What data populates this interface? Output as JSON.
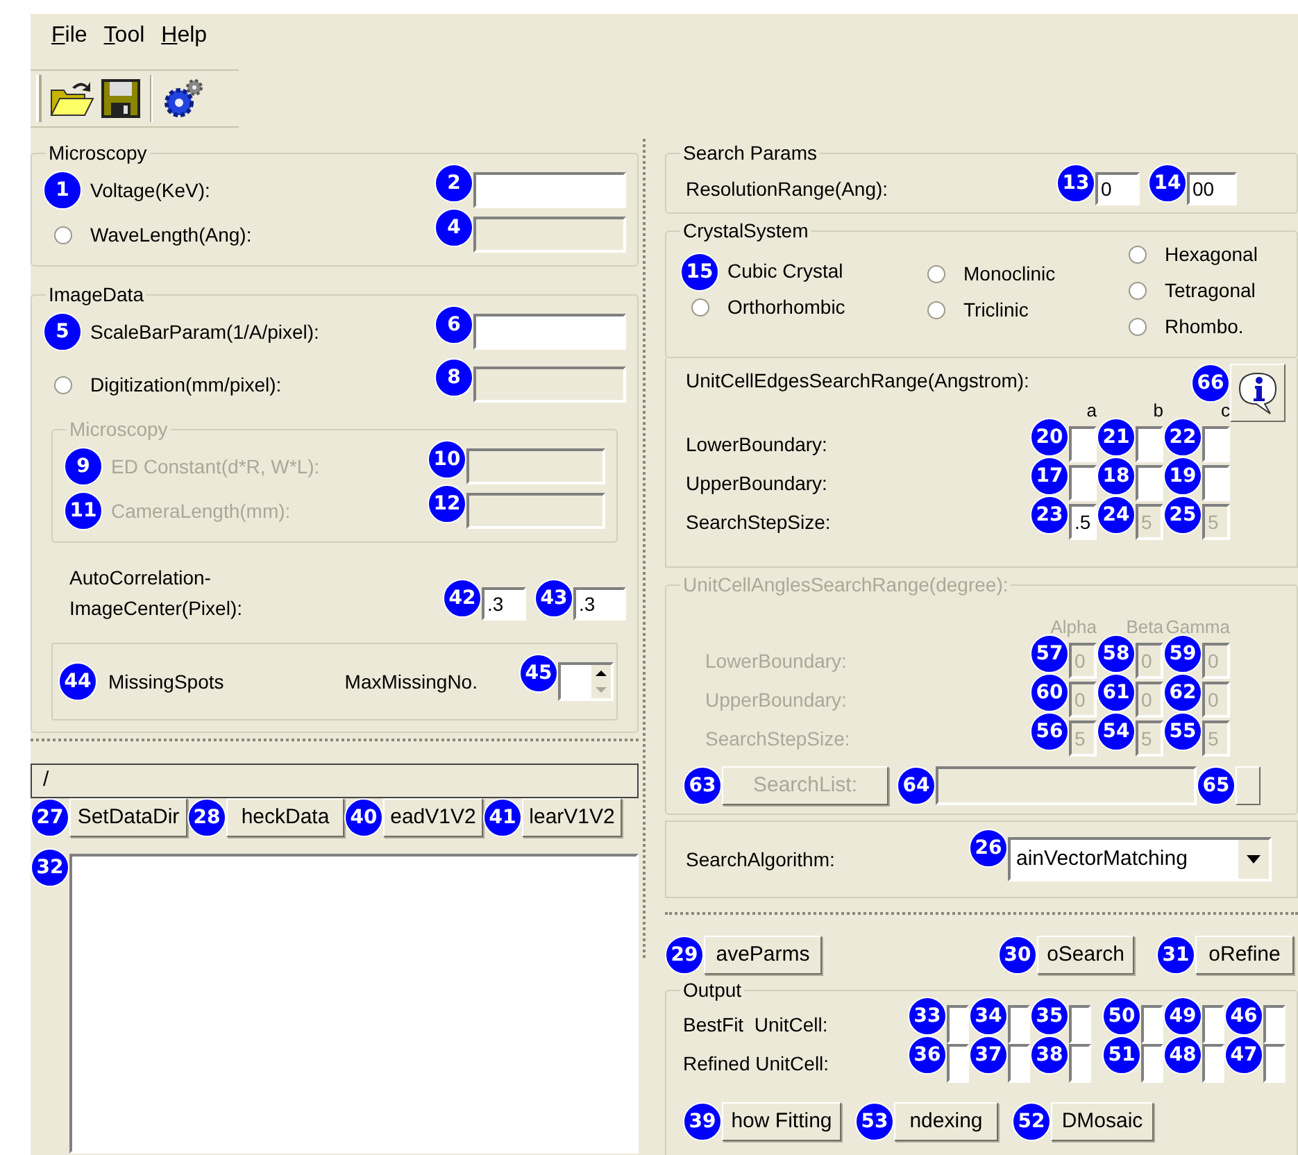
{
  "menu": [
    {
      "label": "File"
    },
    {
      "label": "Tool"
    },
    {
      "label": "Help"
    }
  ],
  "microscopy": {
    "title": "Microscopy",
    "rows": [
      {
        "label": "Voltage(KeV):",
        "badge": "1",
        "field": {
          "badge": "2",
          "disabled": false
        }
      },
      {
        "label": "WaveLength(Ang):",
        "selected": false,
        "field": {
          "badge": "4",
          "disabled": true
        }
      }
    ]
  },
  "image_data": {
    "title": "ImageData",
    "rows": [
      {
        "label": "ScaleBarParam(1/A/pixel):",
        "badge": "5",
        "field": {
          "badge": "6",
          "disabled": false
        }
      },
      {
        "label": "Digitization(mm/pixel):",
        "selected": false,
        "field": {
          "badge": "8",
          "disabled": true
        }
      }
    ],
    "microscopy": {
      "title": "Microscopy",
      "disabled": true,
      "rows": [
        {
          "label": "ED Constant(d*R, W*L):",
          "badge": "9",
          "field": {
            "badge": "10",
            "disabled": true
          }
        },
        {
          "label": "CameraLength(mm):",
          "badge": "11",
          "field": {
            "badge": "12",
            "disabled": true
          }
        }
      ]
    },
    "auto_correlation": {
      "label": "AutoCorrelation-ImageCenter(Pixel):",
      "fields": [
        {
          "badge": "42",
          "value": ".3",
          "disabled": false
        },
        {
          "badge": "43",
          "value": ".3",
          "disabled": false
        }
      ]
    },
    "missing_spots": {
      "label": "MissingSpots",
      "badge": "44",
      "max_label": "MaxMissingNo.",
      "spin": {
        "badge": "45",
        "disabled": false
      }
    }
  },
  "data_dir": {
    "value": "/"
  },
  "data_buttons": [
    {
      "label": "SetDataDir",
      "badge": "27"
    },
    {
      "label": "heckData",
      "badge": "28"
    },
    {
      "label": "eadV1V2",
      "badge": "40"
    },
    {
      "label": "learV1V2",
      "badge": "41"
    }
  ],
  "log": {
    "badge": "32"
  },
  "search_params": {
    "title": "Search Params",
    "label": "ResolutionRange(Ang):",
    "fields": [
      {
        "badge": "13",
        "value": "0",
        "disabled": false
      },
      {
        "badge": "14",
        "value": "00",
        "disabled": false
      }
    ]
  },
  "crystal_system": {
    "title": "CrystalSystem",
    "columns": [
      [
        {
          "label": "Cubic Crystal",
          "badge": "15"
        },
        {
          "label": "Orthorhombic",
          "selected": false
        }
      ],
      [
        {
          "label": "Monoclinic",
          "selected": false
        },
        {
          "label": "Triclinic",
          "selected": false
        }
      ],
      [
        {
          "label": "Hexagonal",
          "selected": false
        },
        {
          "label": "Tetragonal",
          "selected": false
        },
        {
          "label": "Rhombo.",
          "selected": false
        }
      ]
    ]
  },
  "edges": {
    "title": "UnitCellEdgesSearchRange(Angstrom):",
    "info_badge": "66",
    "columns": [
      "a",
      "b",
      "c"
    ],
    "rows": [
      {
        "label": "LowerBoundary:",
        "fields": [
          {
            "badge": "20",
            "disabled": false
          },
          {
            "badge": "21",
            "disabled": false
          },
          {
            "badge": "22",
            "disabled": false
          }
        ]
      },
      {
        "label": "UpperBoundary:",
        "fields": [
          {
            "badge": "17",
            "disabled": false
          },
          {
            "badge": "18",
            "disabled": false
          },
          {
            "badge": "19",
            "disabled": false
          }
        ]
      },
      {
        "label": "SearchStepSize:",
        "fields": [
          {
            "badge": "23",
            "value": ".5",
            "disabled": false
          },
          {
            "badge": "24",
            "value": "5",
            "disabled": true
          },
          {
            "badge": "25",
            "value": "5",
            "disabled": true
          }
        ]
      }
    ]
  },
  "angles": {
    "title": "UnitCellAnglesSearchRange(degree):",
    "disabled": true,
    "columns": [
      "Alpha",
      "Beta",
      "Gamma"
    ],
    "rows": [
      {
        "label": "LowerBoundary:",
        "fields": [
          {
            "badge": "57",
            "value": "0",
            "disabled": true
          },
          {
            "badge": "58",
            "value": "0",
            "disabled": true
          },
          {
            "badge": "59",
            "value": "0",
            "disabled": true
          }
        ]
      },
      {
        "label": "UpperBoundary:",
        "fields": [
          {
            "badge": "60",
            "value": "0",
            "disabled": true
          },
          {
            "badge": "61",
            "value": "0",
            "disabled": true
          },
          {
            "badge": "62",
            "value": "0",
            "disabled": true
          }
        ]
      },
      {
        "label": "SearchStepSize:",
        "fields": [
          {
            "badge": "56",
            "value": "5",
            "disabled": true
          },
          {
            "badge": "54",
            "value": "5",
            "disabled": true
          },
          {
            "badge": "55",
            "value": "5",
            "disabled": true
          }
        ]
      }
    ],
    "search_list": {
      "label": "SearchList:",
      "badge": "63"
    },
    "list": {
      "badge": "64",
      "end_badge": "65"
    }
  },
  "algorithm": {
    "label": "SearchAlgorithm:",
    "badge": "26",
    "value": "ainVectorMatching"
  },
  "action_buttons": [
    {
      "label": "aveParms",
      "badge": "29"
    },
    {
      "label": "oSearch",
      "badge": "30"
    },
    {
      "label": "oRefine",
      "badge": "31"
    }
  ],
  "output": {
    "title": "Output",
    "rows": [
      {
        "label": "BestFit  UnitCell:",
        "fields": [
          {
            "badge": "33",
            "disabled": false
          },
          {
            "badge": "34",
            "disabled": false
          },
          {
            "badge": "35",
            "disabled": false
          },
          {
            "badge": "50",
            "disabled": false
          },
          {
            "badge": "49",
            "disabled": false
          },
          {
            "badge": "46",
            "disabled": false
          }
        ]
      },
      {
        "label": "Refined UnitCell:",
        "fields": [
          {
            "badge": "36",
            "disabled": false
          },
          {
            "badge": "37",
            "disabled": false
          },
          {
            "badge": "38",
            "disabled": false
          },
          {
            "badge": "51",
            "disabled": false
          },
          {
            "badge": "48",
            "disabled": false
          },
          {
            "badge": "47",
            "disabled": false
          }
        ]
      }
    ],
    "buttons": [
      {
        "label": "how Fitting",
        "badge": "39"
      },
      {
        "label": "ndexing",
        "badge": "53"
      },
      {
        "label": "DMosaic",
        "badge": "52"
      }
    ]
  }
}
